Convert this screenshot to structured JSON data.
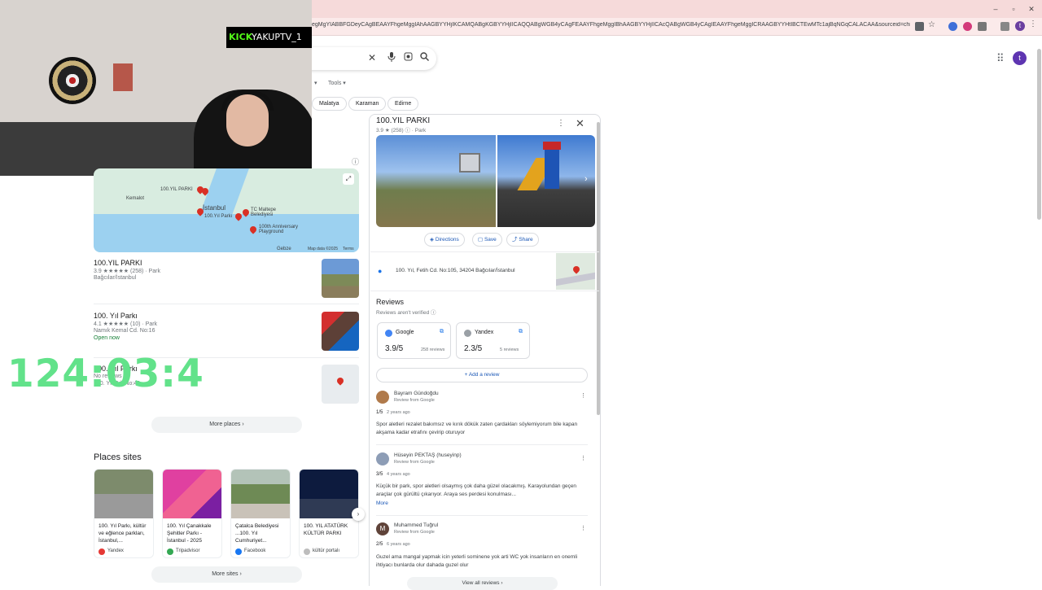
{
  "browser": {
    "url": "egMgYIABBFGDeyCAgBEAAYFhgeMggIAhAAGBYYHjIKCAMQABgKGBYYHjIICAQQABgWGB4yCAgFEAAYFhgeMggIBhAAGBYYHjIICAcQABgWGB4yCAgIEAAYFhgeMggICRAAGBYYHtIBCTEwMTc1ajBqNGqCALACAA&sourceid=chrome&ie=UTF...",
    "profile_initial": "t",
    "accent": "#6b3fa0"
  },
  "search": {
    "clear_icon": "close-icon",
    "voice_icon": "mic-icon",
    "lens_icon": "lens-icon",
    "search_icon": "search-icon"
  },
  "header": {
    "avatar_initial": "t",
    "tools_label": "Tools"
  },
  "chips": [
    "Malatya",
    "Karaman",
    "Edirne"
  ],
  "stream": {
    "platform": "KICK",
    "channel": "YAKUPTV_1",
    "timer": "124:03:4"
  },
  "map": {
    "labels": [
      "100.YIL PARKI",
      "İstanbul",
      "TC Maltepe Belediyesi",
      "100.Yıl Parkı",
      "100th Anniversary Playground",
      "Kemalot",
      "Gebze",
      "Map data ©2025",
      "Terms"
    ]
  },
  "places": [
    {
      "name": "100.YIL PARKI",
      "rating": "3.9 ★★★★★ (258) · Park",
      "line2": "Bağcılar/İstanbul",
      "status": ""
    },
    {
      "name": "100. Yıl Parkı",
      "rating": "4.1 ★★★★★ (10) · Park",
      "line2": "Namık Kemal Cd. No:16",
      "status": "Open now"
    },
    {
      "name": "100. Yıl Parkı",
      "rating": "No reviews",
      "line2": "100. Yıl Cd. No:49",
      "status": ""
    }
  ],
  "more_places_label": "More places",
  "places_sites": {
    "title": "Places sites",
    "cards": [
      {
        "title": "100. Yıl Parkı, kültür ve eğlence parkları, İstanbul,...",
        "source": "Yandex",
        "color": "#e53935"
      },
      {
        "title": "100. Yıl Çanakkale Şehitler Parkı - İstanbul - 2025",
        "source": "Tripadvisor",
        "color": "#34a853"
      },
      {
        "title": "Çatalca Belediyesi ...100. Yıl Cumhuriyet...",
        "source": "Facebook",
        "color": "#1877f2"
      },
      {
        "title": "100. YIL ATATÜRK KÜLTÜR PARKI",
        "source": "kültür portalı",
        "color": "#9e9e9e"
      }
    ],
    "more_label": "More sites"
  },
  "knowledge_panel": {
    "title": "100.YIL PARKI",
    "meta": "3.9 ★ (258) ⓘ · Park",
    "actions": {
      "directions": "Directions",
      "save": "Save",
      "share": "Share"
    },
    "address": "100. Yıl, Fetih Cd. No:105, 34204 Bağcılar/İstanbul",
    "reviews_title": "Reviews",
    "reviews_sub": "Reviews aren't verified ⓘ",
    "sources": [
      {
        "name": "Google",
        "rating": "3.9/5",
        "count": "258 reviews",
        "color": "#4285f4"
      },
      {
        "name": "Yandex",
        "rating": "2.3/5",
        "count": "5 reviews",
        "color": "#9aa0a6"
      }
    ],
    "add_review": "Add a review",
    "reviews": [
      {
        "name": "Bayram Gündoğdu",
        "from": "Review from Google",
        "score": "1/5",
        "age": "2 years ago",
        "text": "Spor aletleri rezalet bakımsız ve kırık dökük zaten çardakları söylemiyorum bile kapan akşama kadar etrafını çevirip oturuyor",
        "avatar_color": "#b07a4b"
      },
      {
        "name": "Hüseyin PEKTAŞ (huseyinp)",
        "from": "Review from Google",
        "score": "3/5",
        "age": "4 years ago",
        "text": "Küçük bir park, spor aletleri olsaymış çok daha güzel olacakmış. Karayolundan geçen araçlar çok gürültü çıkarıyor. Araya ses perdesi konulması...",
        "avatar_color": "#8d9db6"
      },
      {
        "name": "Muhammed Tuğrul",
        "from": "Review from Google",
        "score": "2/5",
        "age": "6 years ago",
        "text": "Guzel ama mangal yapmak icin yeterli sominene yok arti WC yok insanların en onemli ihtiyacı bunlarda olur dahada guzel olur",
        "avatar_color": "#5f4339",
        "avatar_initial": "M"
      }
    ],
    "more_link": "More",
    "view_all": "View all reviews"
  }
}
